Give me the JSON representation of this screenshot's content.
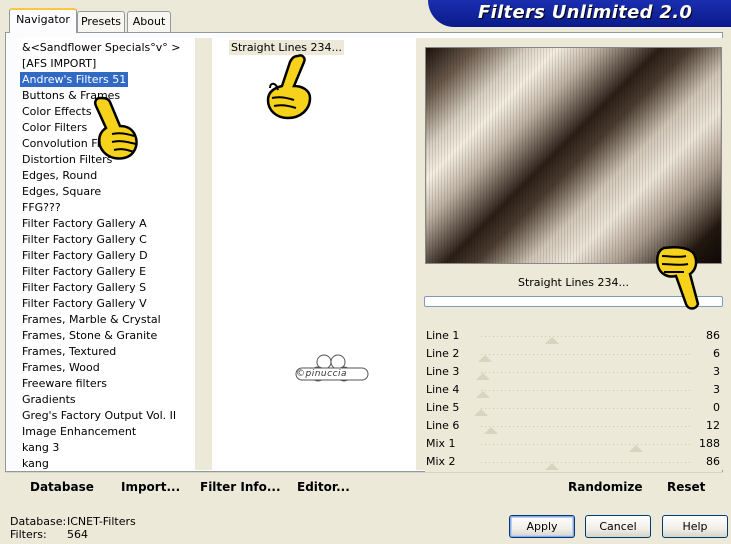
{
  "tabs": [
    {
      "label": "Navigator",
      "active": true
    },
    {
      "label": "Presets",
      "active": false
    },
    {
      "label": "About",
      "active": false
    }
  ],
  "banner": {
    "title": "Filters Unlimited 2.0"
  },
  "categories": [
    "&<Sandflower Specials°v° >",
    "[AFS IMPORT]",
    "Andrew's Filters 51",
    "Buttons & Frames",
    "Color Effects",
    "Color Filters",
    "Convolution Filters",
    "Distortion Filters",
    "Edges, Round",
    "Edges, Square",
    "FFG???",
    "Filter Factory Gallery A",
    "Filter Factory Gallery C",
    "Filter Factory Gallery D",
    "Filter Factory Gallery E",
    "Filter Factory Gallery S",
    "Filter Factory Gallery V",
    "Frames, Marble & Crystal",
    "Frames, Stone & Granite",
    "Frames, Textured",
    "Frames, Wood",
    "Freeware filters",
    "Gradients",
    "Greg's Factory Output Vol. II",
    "Image Enhancement",
    "kang 3",
    "kang"
  ],
  "selected_category_index": 2,
  "filters": [
    "Straight Lines 234..."
  ],
  "preview": {
    "name": "Straight Lines 234...",
    "progress": 0
  },
  "watermark": "©pinuccia",
  "sliders": [
    {
      "name": "Line 1",
      "value": "86",
      "frac": 0.34
    },
    {
      "name": "Line 2",
      "value": "6",
      "frac": 0.02
    },
    {
      "name": "Line 3",
      "value": "3",
      "frac": 0.01
    },
    {
      "name": "Line 4",
      "value": "3",
      "frac": 0.01
    },
    {
      "name": "Line 5",
      "value": "0",
      "frac": 0.0
    },
    {
      "name": "Line 6",
      "value": "12",
      "frac": 0.05
    },
    {
      "name": "Mix 1",
      "value": "188",
      "frac": 0.74
    },
    {
      "name": "Mix 2",
      "value": "86",
      "frac": 0.34
    }
  ],
  "panel_buttons": {
    "database": "Database",
    "import": "Import...",
    "filter_info": "Filter Info...",
    "editor": "Editor...",
    "randomize": "Randomize",
    "reset": "Reset"
  },
  "status": {
    "database_label": "Database:",
    "database_value": "ICNET-Filters",
    "filters_label": "Filters:",
    "filters_value": "564"
  },
  "dialog_buttons": {
    "apply": "Apply",
    "cancel": "Cancel",
    "help": "Help"
  },
  "colors": {
    "selection": "#316ac5",
    "banner": "#0a1a8a",
    "panel_bg": "#ece9d8"
  }
}
